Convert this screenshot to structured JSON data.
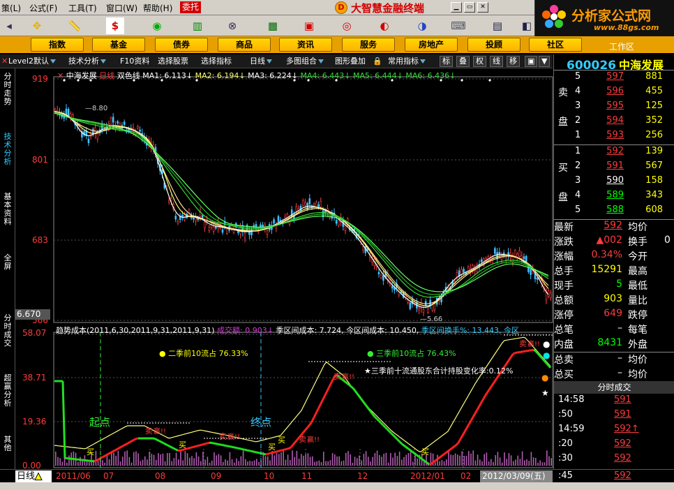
{
  "menu": {
    "items": [
      "策(L)",
      "公式(F)",
      "工具(T)",
      "窗口(W)",
      "帮助(H)",
      "委托"
    ],
    "brand": "大智慧金融终端"
  },
  "watermark": {
    "text": "分析家公式网",
    "url": "www.88gs.com"
  },
  "categories": [
    "指数",
    "基金",
    "债券",
    "商品",
    "资讯",
    "服务",
    "房地产",
    "投顾",
    "社区"
  ],
  "workarea": "工作区",
  "subbar": {
    "level2": "Level2默认",
    "techanalysis": "技术分析",
    "f10": "F10资料",
    "selectstock": "选择股票",
    "selectind": "选择指标",
    "period": "日线",
    "multigraph": "多图组合",
    "overlay": "图形叠加",
    "commonind": "常用指标",
    "b1": "标",
    "b2": "叠",
    "b3": "权",
    "b4": "线",
    "b5": "移"
  },
  "lefttabs": [
    "分时走势",
    "技术分析",
    "基本资料",
    "全屏",
    "分时成交",
    "超赢分析",
    "其他"
  ],
  "chart": {
    "header": {
      "stock": "中海发展",
      "period": "日线",
      "type": "双色线",
      "ma1": "MA1: 6.113↓",
      "ma2": "MA2: 6.194↓",
      "ma3": "MA3: 6.224↓",
      "ma4": "MA4: 6.443↓",
      "ma5": "MA5: 6.444↓",
      "ma6": "MA6: 6.436↓"
    },
    "price_axis": [
      "919",
      "801",
      "683",
      "566"
    ],
    "current_price": "6.670",
    "high_label": "8.80",
    "low_label": "5.66",
    "lower_header": {
      "name": "趋势成本(2011,6,30,2011,9,31,2011,9,31)",
      "vol_label": "成交额: 0",
      "vol2": "903↓",
      "season_cost": "季区间成本: 7.724,",
      "today_cost": "今区间成本: 10.450,",
      "turnover": "季区间换手%: 13.443, 今区"
    },
    "lower_axis": [
      "58.07",
      "38.71",
      "19.36",
      "0.00"
    ],
    "ann1": "二季前10流占 76.33%",
    "ann2": "三季前10流占 76.43%",
    "ann3": "★三季前十流通股东合计持股变化率:0.12%",
    "start_label": "起点",
    "end_label": "终点",
    "sell_label": "卖",
    "buy_label": "买",
    "win_label": "赢!!",
    "dot_markers": [
      "●",
      "●",
      "●",
      "★"
    ],
    "dot_colors": [
      "#ffffff",
      "#00e5e5",
      "#ff8c00",
      "#ffffff"
    ]
  },
  "x_axis": {
    "labels": [
      "2011/06",
      "07",
      "08",
      "09",
      "10",
      "11",
      "12",
      "2012/01",
      "02"
    ],
    "date": "2012/03/09(五)"
  },
  "timeframe": "日线",
  "quote": {
    "code": "600026",
    "name": "中海发展",
    "sell_label": [
      "卖",
      "盘"
    ],
    "buy_label": [
      "买",
      "盘"
    ],
    "sell": [
      {
        "idx": "5",
        "price": "597",
        "vol": "881"
      },
      {
        "idx": "4",
        "price": "596",
        "vol": "455"
      },
      {
        "idx": "3",
        "price": "595",
        "vol": "125"
      },
      {
        "idx": "2",
        "price": "594",
        "vol": "352"
      },
      {
        "idx": "1",
        "price": "593",
        "vol": "256"
      }
    ],
    "buy": [
      {
        "idx": "1",
        "price": "592",
        "vol": "139"
      },
      {
        "idx": "2",
        "price": "591",
        "vol": "567"
      },
      {
        "idx": "3",
        "price": "590",
        "vol": "158"
      },
      {
        "idx": "4",
        "price": "589",
        "vol": "343"
      },
      {
        "idx": "5",
        "price": "588",
        "vol": "608"
      }
    ],
    "stats": [
      {
        "k": "最新",
        "v": "592",
        "vc": "#ff3b3b",
        "k2": "均价",
        "v2": ""
      },
      {
        "k": "涨跌",
        "v": "▲002",
        "vc": "#ff3b3b",
        "k2": "换手",
        "v2": "0"
      },
      {
        "k": "涨幅",
        "v": "0.34%",
        "vc": "#ff3b3b",
        "k2": "今开",
        "v2": ""
      },
      {
        "k": "总手",
        "v": "15291",
        "vc": "#ffff00",
        "k2": "最高",
        "v2": ""
      },
      {
        "k": "现手",
        "v": "5",
        "vc": "#00ff00",
        "k2": "最低",
        "v2": ""
      },
      {
        "k": "总额",
        "v": "903",
        "vc": "#ffff00",
        "k2": "量比",
        "v2": ""
      },
      {
        "k": "涨停",
        "v": "649",
        "vc": "#ff3b3b",
        "k2": "跌停",
        "v2": ""
      },
      {
        "k": "总笔",
        "v": "–",
        "vc": "#ffffff",
        "k2": "每笔",
        "v2": ""
      },
      {
        "k": "内盘",
        "v": "8431",
        "vc": "#00ff00",
        "k2": "外盘",
        "v2": ""
      },
      {
        "k": "总卖",
        "v": "–",
        "vc": "#ffffff",
        "k2": "均价",
        "v2": ""
      },
      {
        "k": "总买",
        "v": "–",
        "vc": "#ffffff",
        "k2": "均价",
        "v2": ""
      }
    ],
    "ticks_title": "分时成交",
    "ticks": [
      {
        "t": "14:58",
        "p": "591"
      },
      {
        "t": ":50",
        "p": "591"
      },
      {
        "t": "14:59",
        "p": "592↑"
      },
      {
        "t": ":20",
        "p": "592"
      },
      {
        "t": ":30",
        "p": "592"
      },
      {
        "t": ":45",
        "p": "592"
      }
    ]
  }
}
